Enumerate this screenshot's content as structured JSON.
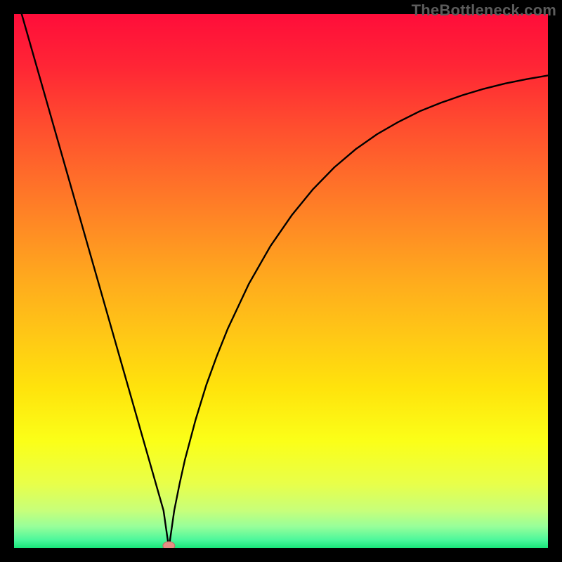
{
  "watermark": "TheBottleneck.com",
  "colors": {
    "background": "#000000",
    "curve": "#000000",
    "marker_fill": "#e78d84",
    "marker_stroke": "#c06a61",
    "gradient_stops": [
      {
        "offset": 0.0,
        "color": "#ff0d3a"
      },
      {
        "offset": 0.1,
        "color": "#ff2635"
      },
      {
        "offset": 0.2,
        "color": "#ff4a2f"
      },
      {
        "offset": 0.3,
        "color": "#ff6b2a"
      },
      {
        "offset": 0.4,
        "color": "#ff8b24"
      },
      {
        "offset": 0.5,
        "color": "#ffab1d"
      },
      {
        "offset": 0.6,
        "color": "#ffc716"
      },
      {
        "offset": 0.7,
        "color": "#ffe30c"
      },
      {
        "offset": 0.8,
        "color": "#fbff18"
      },
      {
        "offset": 0.88,
        "color": "#e8ff4a"
      },
      {
        "offset": 0.93,
        "color": "#c7ff7a"
      },
      {
        "offset": 0.96,
        "color": "#97ff9a"
      },
      {
        "offset": 0.985,
        "color": "#4cf79b"
      },
      {
        "offset": 1.0,
        "color": "#19e57a"
      }
    ]
  },
  "chart_data": {
    "type": "line",
    "title": "",
    "xlabel": "",
    "ylabel": "",
    "xlim": [
      0,
      100
    ],
    "ylim": [
      0,
      100
    ],
    "grid": false,
    "marker": {
      "x": 29,
      "y": 0
    },
    "series": [
      {
        "name": "bottleneck-curve",
        "x": [
          0,
          2,
          4,
          6,
          8,
          10,
          12,
          14,
          16,
          18,
          20,
          22,
          24,
          26,
          27,
          28,
          29,
          30,
          31,
          32,
          34,
          36,
          38,
          40,
          44,
          48,
          52,
          56,
          60,
          64,
          68,
          72,
          76,
          80,
          84,
          88,
          92,
          96,
          100
        ],
        "values": [
          105,
          98,
          91,
          84,
          77,
          70,
          63,
          56,
          49,
          42,
          35,
          28,
          21,
          14,
          10.5,
          7,
          0,
          7,
          12,
          16.5,
          24,
          30.5,
          36,
          41,
          49.5,
          56.5,
          62.3,
          67.2,
          71.3,
          74.7,
          77.5,
          79.8,
          81.8,
          83.4,
          84.8,
          86,
          87,
          87.8,
          88.5
        ]
      }
    ]
  }
}
